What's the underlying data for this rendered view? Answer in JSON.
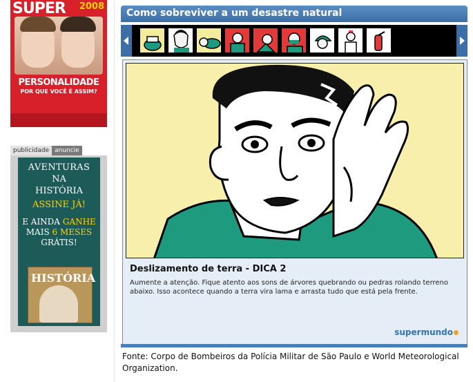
{
  "sidebar": {
    "magazine": {
      "brand": "SUPER",
      "year": "2008",
      "headline": "PERSONALIDADE",
      "subheadline": "POR QUE VOCÊ É ASSIM?"
    },
    "ad_tabs": [
      "publicidade",
      "anuncie"
    ],
    "ad": {
      "line1": "AVENTURAS",
      "line2": "NA",
      "line3": "HISTÓRIA",
      "cta": "ASSINE JÁ!",
      "offer_prefix": "E AINDA",
      "offer_highlight": "GANHE",
      "offer_mid": "MAIS",
      "offer_months": "6 MESES",
      "offer_suffix": "GRÁTIS!",
      "thumb_title": "HISTÓRIA"
    }
  },
  "main": {
    "title": "Como sobreviver a um desastre natural",
    "carousel": {
      "thumb_icons": [
        "kettle-icon",
        "man-face-icon",
        "person-crawling-icon",
        "man-hands-icon",
        "person-smoke-icon",
        "man-mask-icon",
        "person-helmet-icon",
        "nurse-icon",
        "fire-extinguisher-icon"
      ]
    },
    "tip_title": "Deslizamento de terra - DICA 2",
    "tip_text": "Aumente a atenção. Fique atento aos sons de árvores quebrando ou pedras rolando terreno abaixo. Isso acontece quando a terra vira lama e arrasta tudo que está pela frente.",
    "logo": "supermundo",
    "source": "Fonte: Corpo de Bombeiros da Polícia Militar de São Paulo e World Meteorological Organization."
  },
  "colors": {
    "accent_blue": "#3b6fa6",
    "illustration_bg": "#f7efab",
    "shirt_green": "#1e9b7e",
    "magazine_red": "#d8202a",
    "ad_green": "#1d5b59",
    "ad_yellow": "#ffd400"
  }
}
